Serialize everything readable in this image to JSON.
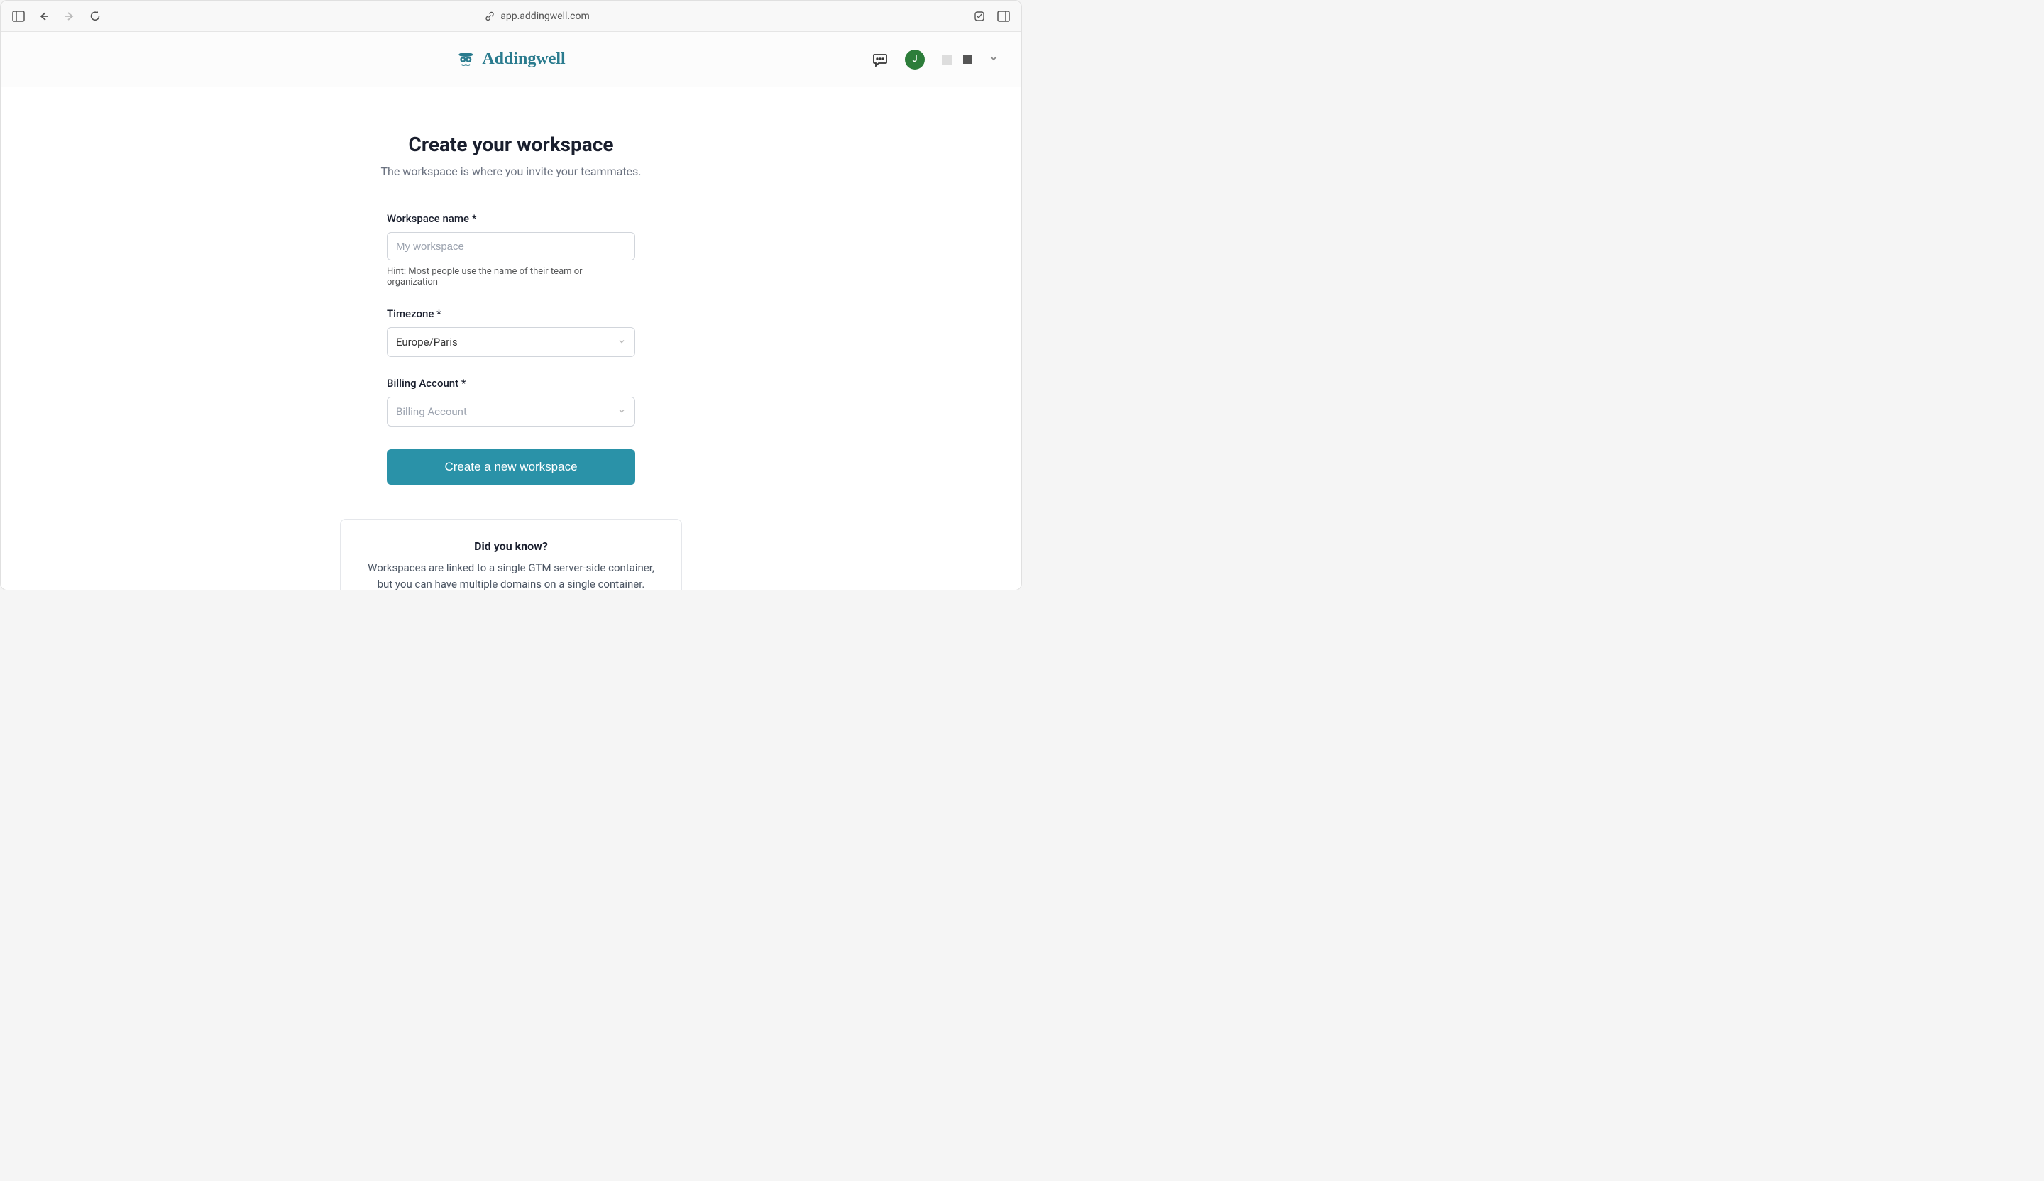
{
  "browser": {
    "url": "app.addingwell.com"
  },
  "logo": {
    "text": "Addingwell"
  },
  "user": {
    "avatar_initial": "J"
  },
  "page": {
    "title": "Create your workspace",
    "subtitle": "The workspace is where you invite your teammates."
  },
  "form": {
    "workspace_name": {
      "label": "Workspace name *",
      "placeholder": "My workspace",
      "value": "",
      "hint": "Hint: Most people use the name of their team or organization"
    },
    "timezone": {
      "label": "Timezone *",
      "value": "Europe/Paris"
    },
    "billing_account": {
      "label": "Billing Account *",
      "placeholder": "Billing Account",
      "value": ""
    },
    "submit_label": "Create a new workspace"
  },
  "info_card": {
    "title": "Did you know?",
    "text": "Workspaces are linked to a single GTM server-side container, but you can have multiple domains on a single container."
  }
}
